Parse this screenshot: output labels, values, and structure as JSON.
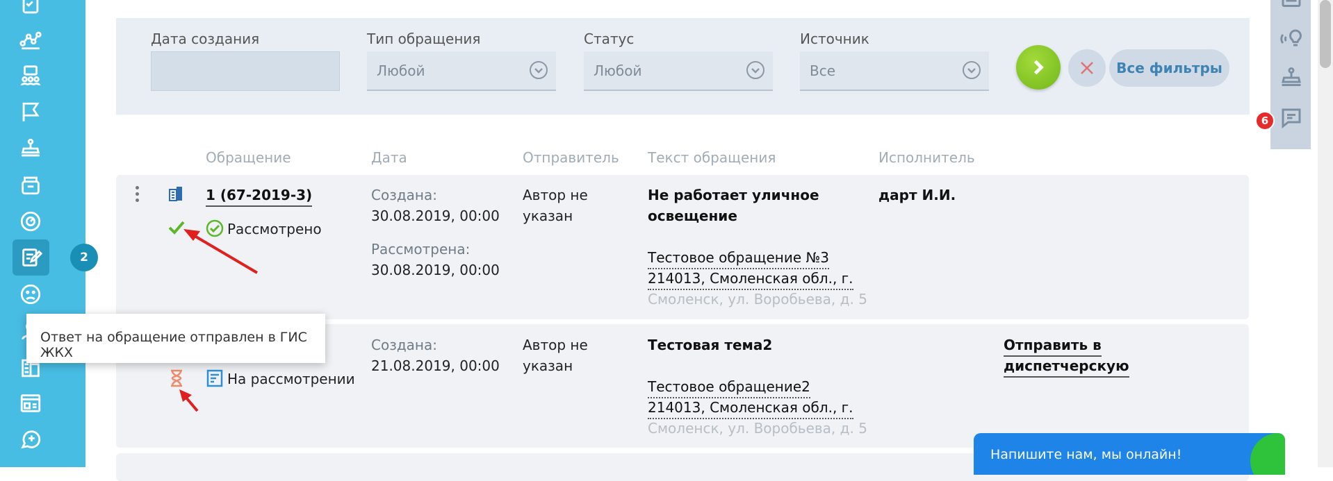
{
  "sidebar": {
    "badge": "2",
    "icons": [
      "checklist-icon",
      "chart-network-icon",
      "people-board-icon",
      "flag-icon",
      "inbox-tray-icon",
      "archive-box-icon",
      "gauge-icon",
      "edit-document-icon",
      "sad-face-icon",
      "users-icon",
      "building-map-icon",
      "id-card-icon",
      "chat-plus-icon"
    ]
  },
  "rightbar": {
    "badge": "6",
    "icons": [
      "card-icon",
      "broadcast-bulb-icon",
      "inbox-tray-icon",
      "chat-bubble-icon"
    ]
  },
  "filters": {
    "date_label": "Дата создания",
    "date_value": "",
    "type_label": "Тип обращения",
    "type_value": "Любой",
    "status_label": "Статус",
    "status_value": "Любой",
    "source_label": "Источник",
    "source_value": "Все",
    "all_filters": "Все фильтры"
  },
  "table": {
    "headers": {
      "request": "Обращение",
      "date": "Дата",
      "sender": "Отправитель",
      "text": "Текст обращения",
      "executor": "Исполнитель"
    },
    "rows": [
      {
        "number": "1 (67-2019-3)",
        "status": "Рассмотрено",
        "created_label": "Создана:",
        "created": "30.08.2019, 00:00",
        "reviewed_label": "Рассмотрена:",
        "reviewed": "30.08.2019, 00:00",
        "sender_line1": "Автор не",
        "sender_line2": "указан",
        "title_line1": "Не работает уличное",
        "title_line2": "освещение",
        "subject": "Тестовое обращение №3",
        "address_line1": "214013, Смоленская обл., г.",
        "address_line2": "Смоленск, ул. Воробьева, д. 5",
        "executor": "дарт И.И."
      },
      {
        "status": "На рассмотрении",
        "created_label": "Создана:",
        "created": "21.08.2019, 00:00",
        "sender_line1": "Автор не",
        "sender_line2": "указан",
        "title_line1": "Тестовая тема2",
        "subject": "Тестовое обращение2",
        "address_line1": "214013, Смоленская обл., г.",
        "address_line2": "Смоленск, ул. Воробьева, д. 5",
        "action_line1": "Отправить в",
        "action_line2": "диспетчерскую"
      }
    ]
  },
  "tooltip": "Ответ на обращение отправлен в ГИС ЖКХ",
  "chat_widget": "Напишите нам, мы онлайн!",
  "colors": {
    "sidebar": "#48bde3",
    "accent_green": "#72b81b",
    "annotation_red": "#e0201f"
  }
}
